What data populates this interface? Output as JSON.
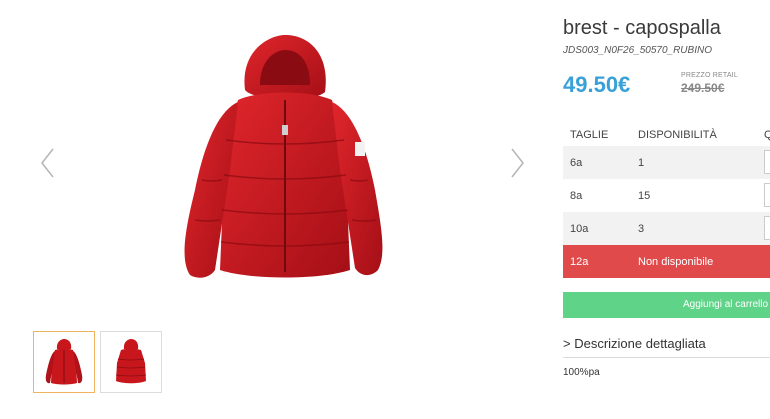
{
  "product": {
    "title": "brest - capospalla",
    "sku": "JDS003_N0F26_50570_RUBINO",
    "price": "49.50€",
    "retail_label": "PREZZO RETAIL",
    "retail_price": "249.50€"
  },
  "sizes_table": {
    "headers": [
      "TAGLIE",
      "DISPONIBILITÀ",
      "Q"
    ],
    "rows": [
      {
        "size": "6a",
        "availability": "1"
      },
      {
        "size": "8a",
        "availability": "15"
      },
      {
        "size": "10a",
        "availability": "3"
      },
      {
        "size": "12a",
        "availability": "Non disponibile"
      }
    ]
  },
  "cart_button": "Aggiungi al carrello",
  "description": {
    "toggle": "> Descrizione dettagliata",
    "material": "100%pa"
  },
  "colors": {
    "price": "#3aa1d8",
    "unavailable": "#e04a4a",
    "cart": "#5fd488",
    "jacket": "#c8161d"
  }
}
